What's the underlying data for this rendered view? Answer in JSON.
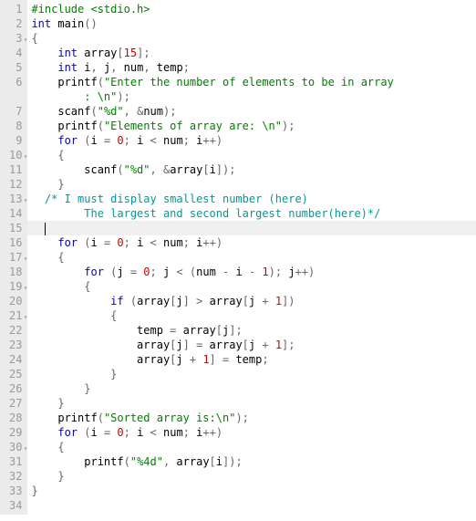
{
  "code": {
    "lines": [
      {
        "n": 1,
        "fold": false,
        "parts": [
          {
            "t": "#include ",
            "c": "pp"
          },
          {
            "t": "<stdio.h>",
            "c": "str"
          }
        ]
      },
      {
        "n": 2,
        "fold": false,
        "parts": [
          {
            "t": "int",
            "c": "kw"
          },
          {
            "t": " main",
            "c": "id"
          },
          {
            "t": "()",
            "c": "op"
          }
        ]
      },
      {
        "n": 3,
        "fold": true,
        "parts": [
          {
            "t": "{",
            "c": "op"
          }
        ]
      },
      {
        "n": 4,
        "fold": false,
        "parts": [
          {
            "t": "    ",
            "c": "id"
          },
          {
            "t": "int",
            "c": "kw"
          },
          {
            "t": " array",
            "c": "id"
          },
          {
            "t": "[",
            "c": "op"
          },
          {
            "t": "15",
            "c": "num"
          },
          {
            "t": "];",
            "c": "op"
          }
        ]
      },
      {
        "n": 5,
        "fold": false,
        "parts": [
          {
            "t": "    ",
            "c": "id"
          },
          {
            "t": "int",
            "c": "kw"
          },
          {
            "t": " i",
            "c": "id"
          },
          {
            "t": ", ",
            "c": "op"
          },
          {
            "t": "j",
            "c": "id"
          },
          {
            "t": ", ",
            "c": "op"
          },
          {
            "t": "num",
            "c": "id"
          },
          {
            "t": ", ",
            "c": "op"
          },
          {
            "t": "temp",
            "c": "id"
          },
          {
            "t": ";",
            "c": "op"
          }
        ]
      },
      {
        "n": 6,
        "fold": false,
        "parts": [
          {
            "t": "    printf",
            "c": "id"
          },
          {
            "t": "(",
            "c": "op"
          },
          {
            "t": "\"Enter the number of elements to be in array",
            "c": "str"
          }
        ]
      },
      {
        "n": "",
        "fold": false,
        "parts": [
          {
            "t": "        : \\n\"",
            "c": "str"
          },
          {
            "t": ");",
            "c": "op"
          }
        ]
      },
      {
        "n": 7,
        "fold": false,
        "parts": [
          {
            "t": "    scanf",
            "c": "id"
          },
          {
            "t": "(",
            "c": "op"
          },
          {
            "t": "\"%d\"",
            "c": "str"
          },
          {
            "t": ", &",
            "c": "op"
          },
          {
            "t": "num",
            "c": "id"
          },
          {
            "t": ");",
            "c": "op"
          }
        ]
      },
      {
        "n": 8,
        "fold": false,
        "parts": [
          {
            "t": "    printf",
            "c": "id"
          },
          {
            "t": "(",
            "c": "op"
          },
          {
            "t": "\"Elements of array are: \\n\"",
            "c": "str"
          },
          {
            "t": ");",
            "c": "op"
          }
        ]
      },
      {
        "n": 9,
        "fold": false,
        "parts": [
          {
            "t": "    ",
            "c": "id"
          },
          {
            "t": "for",
            "c": "kw"
          },
          {
            "t": " (",
            "c": "op"
          },
          {
            "t": "i ",
            "c": "id"
          },
          {
            "t": "= ",
            "c": "op"
          },
          {
            "t": "0",
            "c": "num"
          },
          {
            "t": "; ",
            "c": "op"
          },
          {
            "t": "i ",
            "c": "id"
          },
          {
            "t": "< ",
            "c": "op"
          },
          {
            "t": "num",
            "c": "id"
          },
          {
            "t": "; ",
            "c": "op"
          },
          {
            "t": "i",
            "c": "id"
          },
          {
            "t": "++)",
            "c": "op"
          }
        ]
      },
      {
        "n": 10,
        "fold": true,
        "parts": [
          {
            "t": "    {",
            "c": "op"
          }
        ]
      },
      {
        "n": 11,
        "fold": false,
        "parts": [
          {
            "t": "        scanf",
            "c": "id"
          },
          {
            "t": "(",
            "c": "op"
          },
          {
            "t": "\"%d\"",
            "c": "str"
          },
          {
            "t": ", &",
            "c": "op"
          },
          {
            "t": "array",
            "c": "id"
          },
          {
            "t": "[",
            "c": "op"
          },
          {
            "t": "i",
            "c": "id"
          },
          {
            "t": "]);",
            "c": "op"
          }
        ]
      },
      {
        "n": 12,
        "fold": false,
        "parts": [
          {
            "t": "    }",
            "c": "op"
          }
        ]
      },
      {
        "n": 13,
        "fold": true,
        "parts": [
          {
            "t": "  ",
            "c": "id"
          },
          {
            "t": "/* I must display smallest number (here)",
            "c": "cm"
          }
        ]
      },
      {
        "n": 14,
        "fold": false,
        "parts": [
          {
            "t": "        The largest and second largest number(here)*/",
            "c": "cm"
          }
        ]
      },
      {
        "n": 15,
        "fold": false,
        "active": true,
        "cursor": true,
        "parts": [
          {
            "t": "  ",
            "c": "id"
          }
        ]
      },
      {
        "n": 16,
        "fold": false,
        "parts": [
          {
            "t": "    ",
            "c": "id"
          },
          {
            "t": "for",
            "c": "kw"
          },
          {
            "t": " (",
            "c": "op"
          },
          {
            "t": "i ",
            "c": "id"
          },
          {
            "t": "= ",
            "c": "op"
          },
          {
            "t": "0",
            "c": "num"
          },
          {
            "t": "; ",
            "c": "op"
          },
          {
            "t": "i ",
            "c": "id"
          },
          {
            "t": "< ",
            "c": "op"
          },
          {
            "t": "num",
            "c": "id"
          },
          {
            "t": "; ",
            "c": "op"
          },
          {
            "t": "i",
            "c": "id"
          },
          {
            "t": "++)",
            "c": "op"
          }
        ]
      },
      {
        "n": 17,
        "fold": true,
        "parts": [
          {
            "t": "    {",
            "c": "op"
          }
        ]
      },
      {
        "n": 18,
        "fold": false,
        "parts": [
          {
            "t": "        ",
            "c": "id"
          },
          {
            "t": "for",
            "c": "kw"
          },
          {
            "t": " (",
            "c": "op"
          },
          {
            "t": "j ",
            "c": "id"
          },
          {
            "t": "= ",
            "c": "op"
          },
          {
            "t": "0",
            "c": "num"
          },
          {
            "t": "; ",
            "c": "op"
          },
          {
            "t": "j ",
            "c": "id"
          },
          {
            "t": "< (",
            "c": "op"
          },
          {
            "t": "num ",
            "c": "id"
          },
          {
            "t": "- ",
            "c": "op"
          },
          {
            "t": "i ",
            "c": "id"
          },
          {
            "t": "- ",
            "c": "op"
          },
          {
            "t": "1",
            "c": "num"
          },
          {
            "t": "); ",
            "c": "op"
          },
          {
            "t": "j",
            "c": "id"
          },
          {
            "t": "++)",
            "c": "op"
          }
        ]
      },
      {
        "n": 19,
        "fold": true,
        "parts": [
          {
            "t": "        {",
            "c": "op"
          }
        ]
      },
      {
        "n": 20,
        "fold": false,
        "parts": [
          {
            "t": "            ",
            "c": "id"
          },
          {
            "t": "if",
            "c": "kw"
          },
          {
            "t": " (",
            "c": "op"
          },
          {
            "t": "array",
            "c": "id"
          },
          {
            "t": "[",
            "c": "op"
          },
          {
            "t": "j",
            "c": "id"
          },
          {
            "t": "] > ",
            "c": "op"
          },
          {
            "t": "array",
            "c": "id"
          },
          {
            "t": "[",
            "c": "op"
          },
          {
            "t": "j ",
            "c": "id"
          },
          {
            "t": "+ ",
            "c": "op"
          },
          {
            "t": "1",
            "c": "num"
          },
          {
            "t": "])",
            "c": "op"
          }
        ]
      },
      {
        "n": 21,
        "fold": true,
        "parts": [
          {
            "t": "            {",
            "c": "op"
          }
        ]
      },
      {
        "n": 22,
        "fold": false,
        "parts": [
          {
            "t": "                temp ",
            "c": "id"
          },
          {
            "t": "= ",
            "c": "op"
          },
          {
            "t": "array",
            "c": "id"
          },
          {
            "t": "[",
            "c": "op"
          },
          {
            "t": "j",
            "c": "id"
          },
          {
            "t": "];",
            "c": "op"
          }
        ]
      },
      {
        "n": 23,
        "fold": false,
        "parts": [
          {
            "t": "                array",
            "c": "id"
          },
          {
            "t": "[",
            "c": "op"
          },
          {
            "t": "j",
            "c": "id"
          },
          {
            "t": "] = ",
            "c": "op"
          },
          {
            "t": "array",
            "c": "id"
          },
          {
            "t": "[",
            "c": "op"
          },
          {
            "t": "j ",
            "c": "id"
          },
          {
            "t": "+ ",
            "c": "op"
          },
          {
            "t": "1",
            "c": "num"
          },
          {
            "t": "];",
            "c": "op"
          }
        ]
      },
      {
        "n": 24,
        "fold": false,
        "parts": [
          {
            "t": "                array",
            "c": "id"
          },
          {
            "t": "[",
            "c": "op"
          },
          {
            "t": "j ",
            "c": "id"
          },
          {
            "t": "+ ",
            "c": "op"
          },
          {
            "t": "1",
            "c": "num"
          },
          {
            "t": "] = ",
            "c": "op"
          },
          {
            "t": "temp",
            "c": "id"
          },
          {
            "t": ";",
            "c": "op"
          }
        ]
      },
      {
        "n": 25,
        "fold": false,
        "parts": [
          {
            "t": "            }",
            "c": "op"
          }
        ]
      },
      {
        "n": 26,
        "fold": false,
        "parts": [
          {
            "t": "        }",
            "c": "op"
          }
        ]
      },
      {
        "n": 27,
        "fold": false,
        "parts": [
          {
            "t": "    }",
            "c": "op"
          }
        ]
      },
      {
        "n": 28,
        "fold": false,
        "parts": [
          {
            "t": "    printf",
            "c": "id"
          },
          {
            "t": "(",
            "c": "op"
          },
          {
            "t": "\"Sorted array is:\\n\"",
            "c": "str"
          },
          {
            "t": ");",
            "c": "op"
          }
        ]
      },
      {
        "n": 29,
        "fold": false,
        "parts": [
          {
            "t": "    ",
            "c": "id"
          },
          {
            "t": "for",
            "c": "kw"
          },
          {
            "t": " (",
            "c": "op"
          },
          {
            "t": "i ",
            "c": "id"
          },
          {
            "t": "= ",
            "c": "op"
          },
          {
            "t": "0",
            "c": "num"
          },
          {
            "t": "; ",
            "c": "op"
          },
          {
            "t": "i ",
            "c": "id"
          },
          {
            "t": "< ",
            "c": "op"
          },
          {
            "t": "num",
            "c": "id"
          },
          {
            "t": "; ",
            "c": "op"
          },
          {
            "t": "i",
            "c": "id"
          },
          {
            "t": "++)",
            "c": "op"
          }
        ]
      },
      {
        "n": 30,
        "fold": true,
        "parts": [
          {
            "t": "    {",
            "c": "op"
          }
        ]
      },
      {
        "n": 31,
        "fold": false,
        "parts": [
          {
            "t": "        printf",
            "c": "id"
          },
          {
            "t": "(",
            "c": "op"
          },
          {
            "t": "\"%4d\"",
            "c": "str"
          },
          {
            "t": ", ",
            "c": "op"
          },
          {
            "t": "array",
            "c": "id"
          },
          {
            "t": "[",
            "c": "op"
          },
          {
            "t": "i",
            "c": "id"
          },
          {
            "t": "]);",
            "c": "op"
          }
        ]
      },
      {
        "n": 32,
        "fold": false,
        "parts": [
          {
            "t": "    }",
            "c": "op"
          }
        ]
      },
      {
        "n": 33,
        "fold": false,
        "parts": [
          {
            "t": "}",
            "c": "op"
          }
        ]
      },
      {
        "n": 34,
        "fold": false,
        "parts": []
      }
    ]
  }
}
